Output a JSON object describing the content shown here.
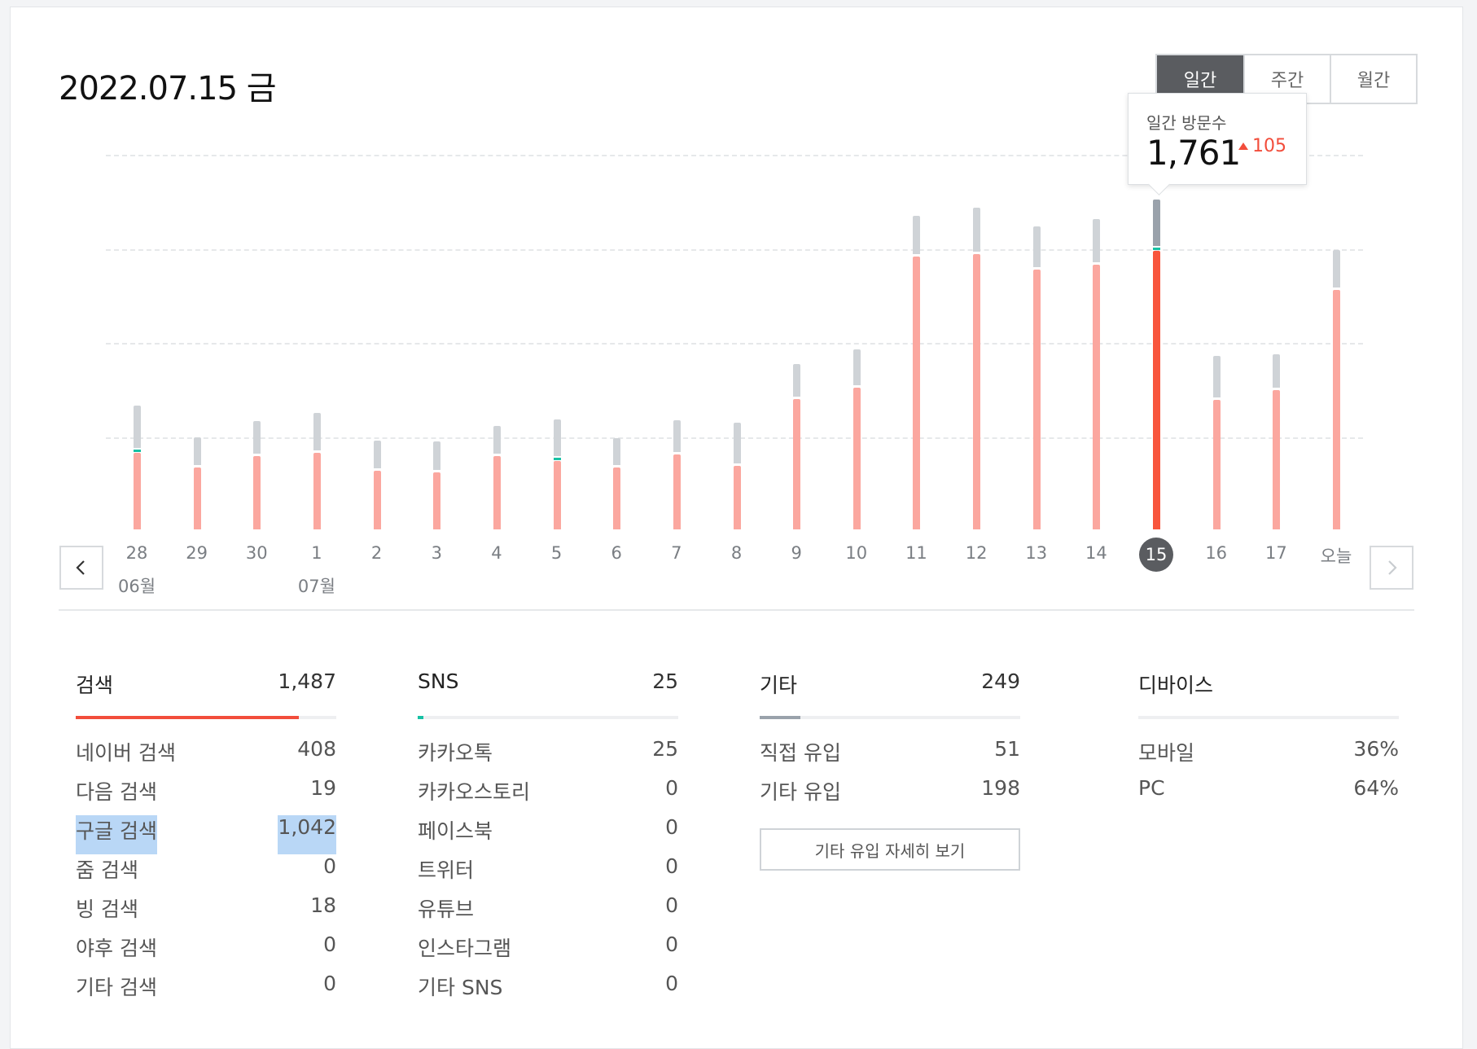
{
  "title": "2022.07.15 금",
  "period_tabs": [
    {
      "label": "일간",
      "active": true
    },
    {
      "label": "주간",
      "active": false
    },
    {
      "label": "월간",
      "active": false
    }
  ],
  "tooltip": {
    "label": "일간 방문수",
    "value": "1,761",
    "delta": "105",
    "delta_color": "#f24d3b"
  },
  "chart_data": {
    "type": "bar",
    "stacked": true,
    "grid": true,
    "categories": [
      "28",
      "29",
      "30",
      "1",
      "2",
      "3",
      "4",
      "5",
      "6",
      "7",
      "8",
      "9",
      "10",
      "11",
      "12",
      "13",
      "14",
      "15",
      "16",
      "17",
      "오늘"
    ],
    "month_labels": [
      {
        "index": 0,
        "label": "06월"
      },
      {
        "index": 3,
        "label": "07월"
      }
    ],
    "selected_index": 17,
    "series": [
      {
        "color": "#fba79f",
        "values": [
          410,
          330,
          390,
          410,
          315,
          305,
          390,
          365,
          330,
          400,
          340,
          695,
          755,
          1455,
          1470,
          1385,
          1415,
          1487,
          690,
          745,
          1280
        ]
      },
      {
        "color": "#17c1a4",
        "values": [
          10,
          0,
          0,
          0,
          0,
          0,
          0,
          5,
          0,
          0,
          0,
          0,
          0,
          0,
          0,
          0,
          0,
          25,
          0,
          0,
          0
        ]
      },
      {
        "color": "#cfd3d7",
        "values": [
          225,
          150,
          175,
          200,
          145,
          150,
          150,
          195,
          145,
          170,
          215,
          175,
          195,
          205,
          235,
          220,
          230,
          249,
          225,
          175,
          200
        ]
      }
    ],
    "ylim": [
      0,
      2000
    ]
  },
  "sections": {
    "search": {
      "title": "검색",
      "total": "1,487",
      "fill_fraction": 0.855,
      "color": "#f24d3b",
      "rows": [
        {
          "label": "네이버 검색",
          "value": "408"
        },
        {
          "label": "다음 검색",
          "value": "19"
        },
        {
          "label": "구글 검색",
          "value": "1,042"
        },
        {
          "label": "줌 검색",
          "value": "0"
        },
        {
          "label": "빙 검색",
          "value": "18"
        },
        {
          "label": "야후 검색",
          "value": "0"
        },
        {
          "label": "기타 검색",
          "value": "0"
        }
      ]
    },
    "sns": {
      "title": "SNS",
      "total": "25",
      "fill_fraction": 0.022,
      "color": "#17c1a4",
      "rows": [
        {
          "label": "카카오톡",
          "value": "25"
        },
        {
          "label": "카카오스토리",
          "value": "0"
        },
        {
          "label": "페이스북",
          "value": "0"
        },
        {
          "label": "트위터",
          "value": "0"
        },
        {
          "label": "유튜브",
          "value": "0"
        },
        {
          "label": "인스타그램",
          "value": "0"
        },
        {
          "label": "기타 SNS",
          "value": "0"
        }
      ]
    },
    "other": {
      "title": "기타",
      "total": "249",
      "fill_fraction": 0.155,
      "color": "#9aa2ab",
      "rows": [
        {
          "label": "직접 유입",
          "value": "51"
        },
        {
          "label": "기타 유입",
          "value": "198"
        }
      ],
      "detail_button": "기타 유입 자세히 보기"
    },
    "device": {
      "title": "디바이스",
      "rows": [
        {
          "label": "모바일",
          "value": "36%"
        },
        {
          "label": "PC",
          "value": "64%"
        }
      ]
    }
  }
}
